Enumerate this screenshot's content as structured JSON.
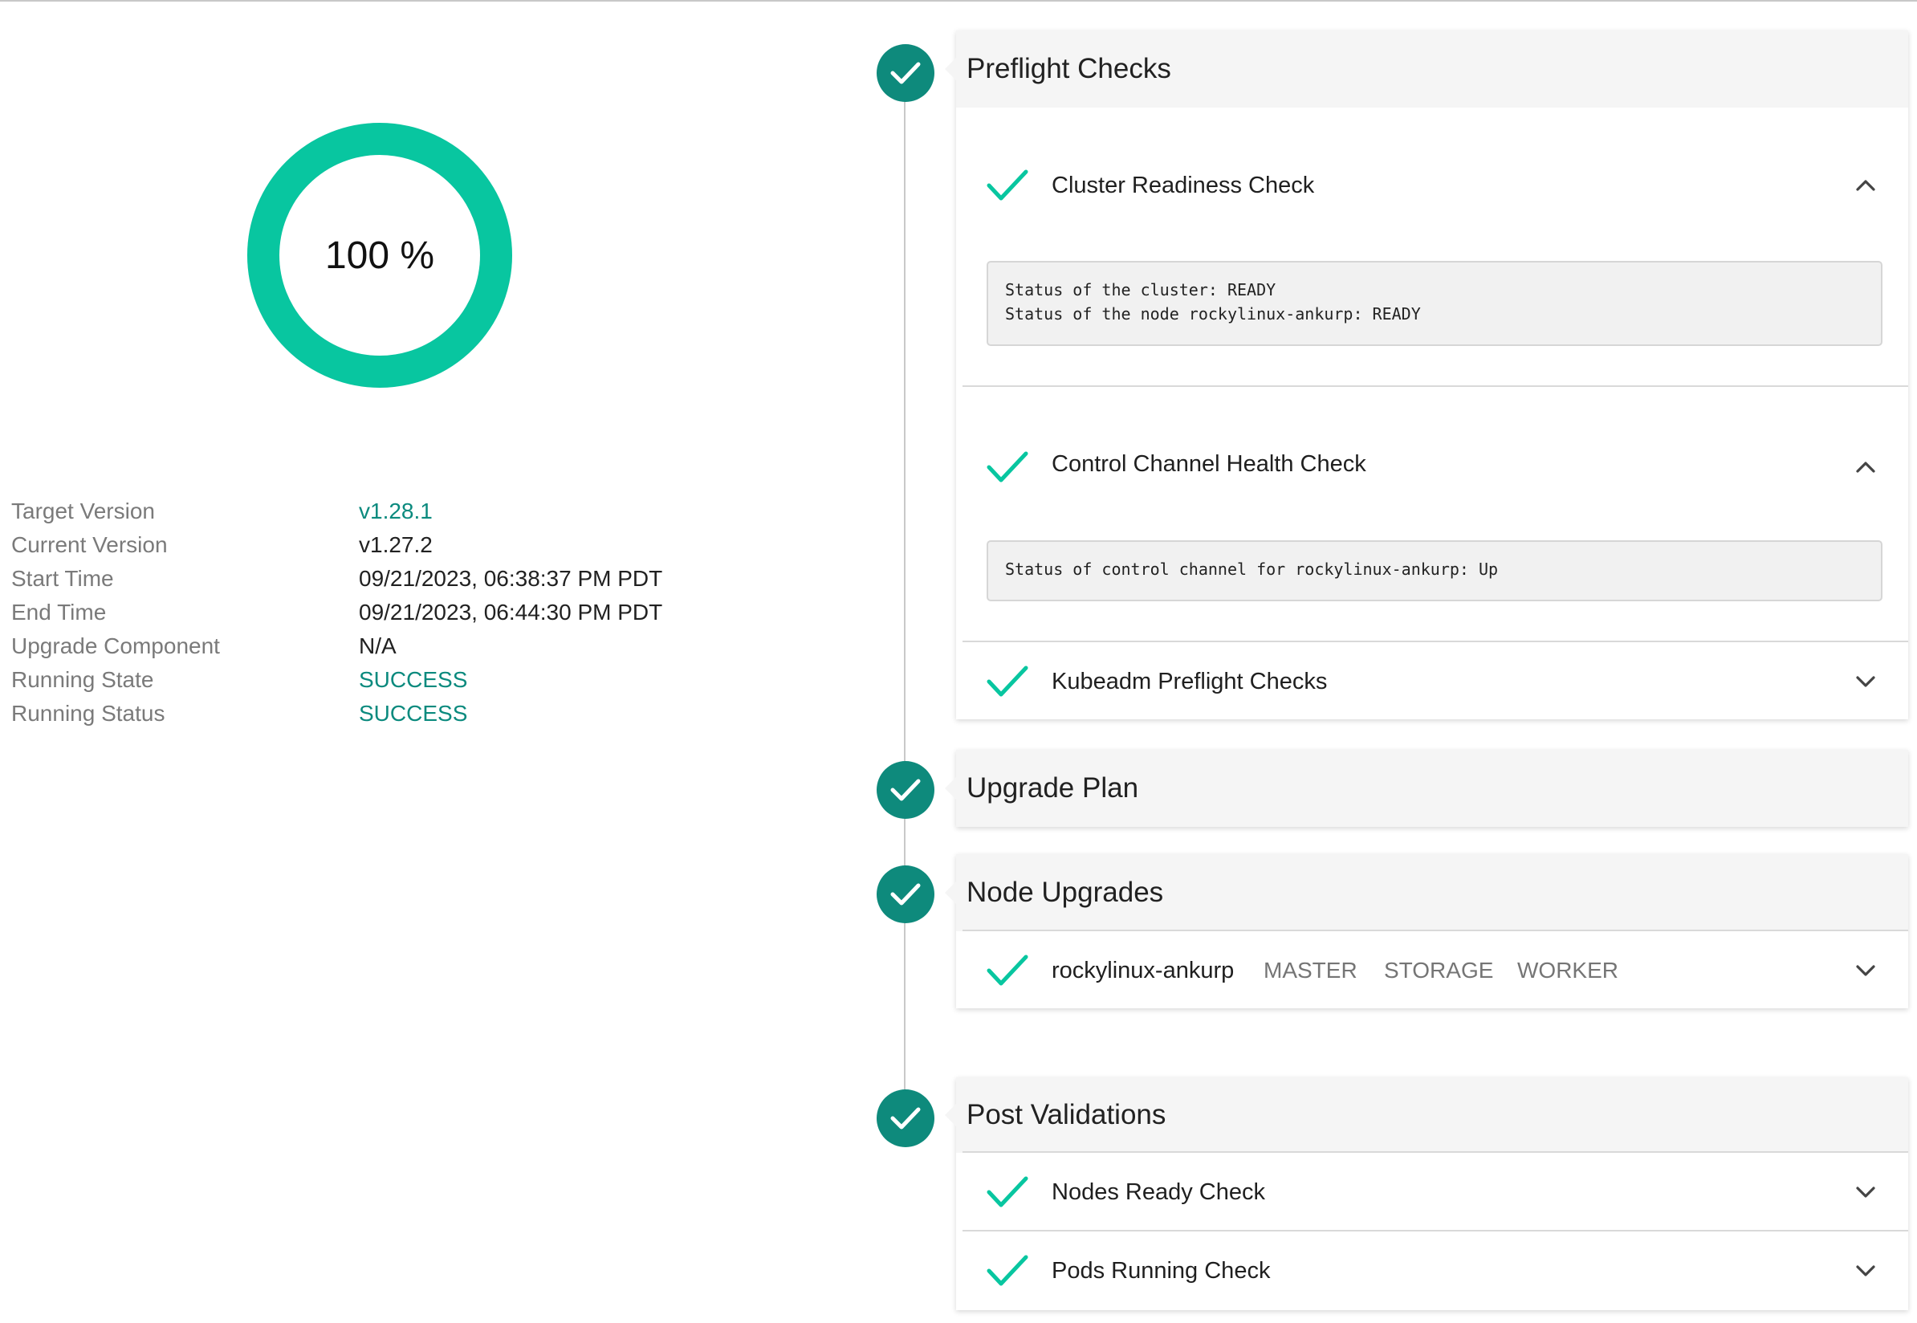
{
  "progress": {
    "label": "100 %",
    "value": 1.0,
    "color": "#08c6a0"
  },
  "info": {
    "rows": [
      {
        "label": "Target Version",
        "value": "v1.28.1",
        "accent": true
      },
      {
        "label": "Current Version",
        "value": "v1.27.2",
        "accent": false
      },
      {
        "label": "Start Time",
        "value": "09/21/2023, 06:38:37 PM PDT",
        "accent": false
      },
      {
        "label": "End Time",
        "value": "09/21/2023, 06:44:30 PM PDT",
        "accent": false
      },
      {
        "label": "Upgrade Component",
        "value": "N/A",
        "accent": false
      },
      {
        "label": "Running State",
        "value": "SUCCESS",
        "accent": true
      },
      {
        "label": "Running Status",
        "value": "SUCCESS",
        "accent": true
      }
    ]
  },
  "steps": {
    "preflight": {
      "title": "Preflight Checks",
      "items": [
        {
          "label": "Cluster Readiness Check",
          "expanded": true
        },
        {
          "label": "Control Channel Health Check",
          "expanded": true
        },
        {
          "label": "Kubeadm Preflight Checks",
          "expanded": false
        }
      ],
      "logs": {
        "cluster_readiness": "Status of the cluster: READY\nStatus of the node rockylinux-ankurp: READY",
        "control_channel": "Status of control channel for rockylinux-ankurp: Up"
      }
    },
    "upgrade_plan": {
      "title": "Upgrade Plan"
    },
    "node_upgrades": {
      "title": "Node Upgrades",
      "node": {
        "name": "rockylinux-ankurp",
        "roles": [
          "MASTER",
          "STORAGE",
          "WORKER"
        ]
      }
    },
    "post_validations": {
      "title": "Post Validations",
      "items": [
        {
          "label": "Nodes Ready Check",
          "expanded": false
        },
        {
          "label": "Pods Running Check",
          "expanded": false
        }
      ]
    }
  },
  "icons": {
    "step_complete": "check-circle-icon",
    "item_complete": "check-icon",
    "expanded": "chevron-up-icon",
    "collapsed": "chevron-down-icon"
  },
  "colors": {
    "step_marker": "#0e8a7c",
    "check": "#08c6a0",
    "accent_text": "#0b8a7e"
  }
}
